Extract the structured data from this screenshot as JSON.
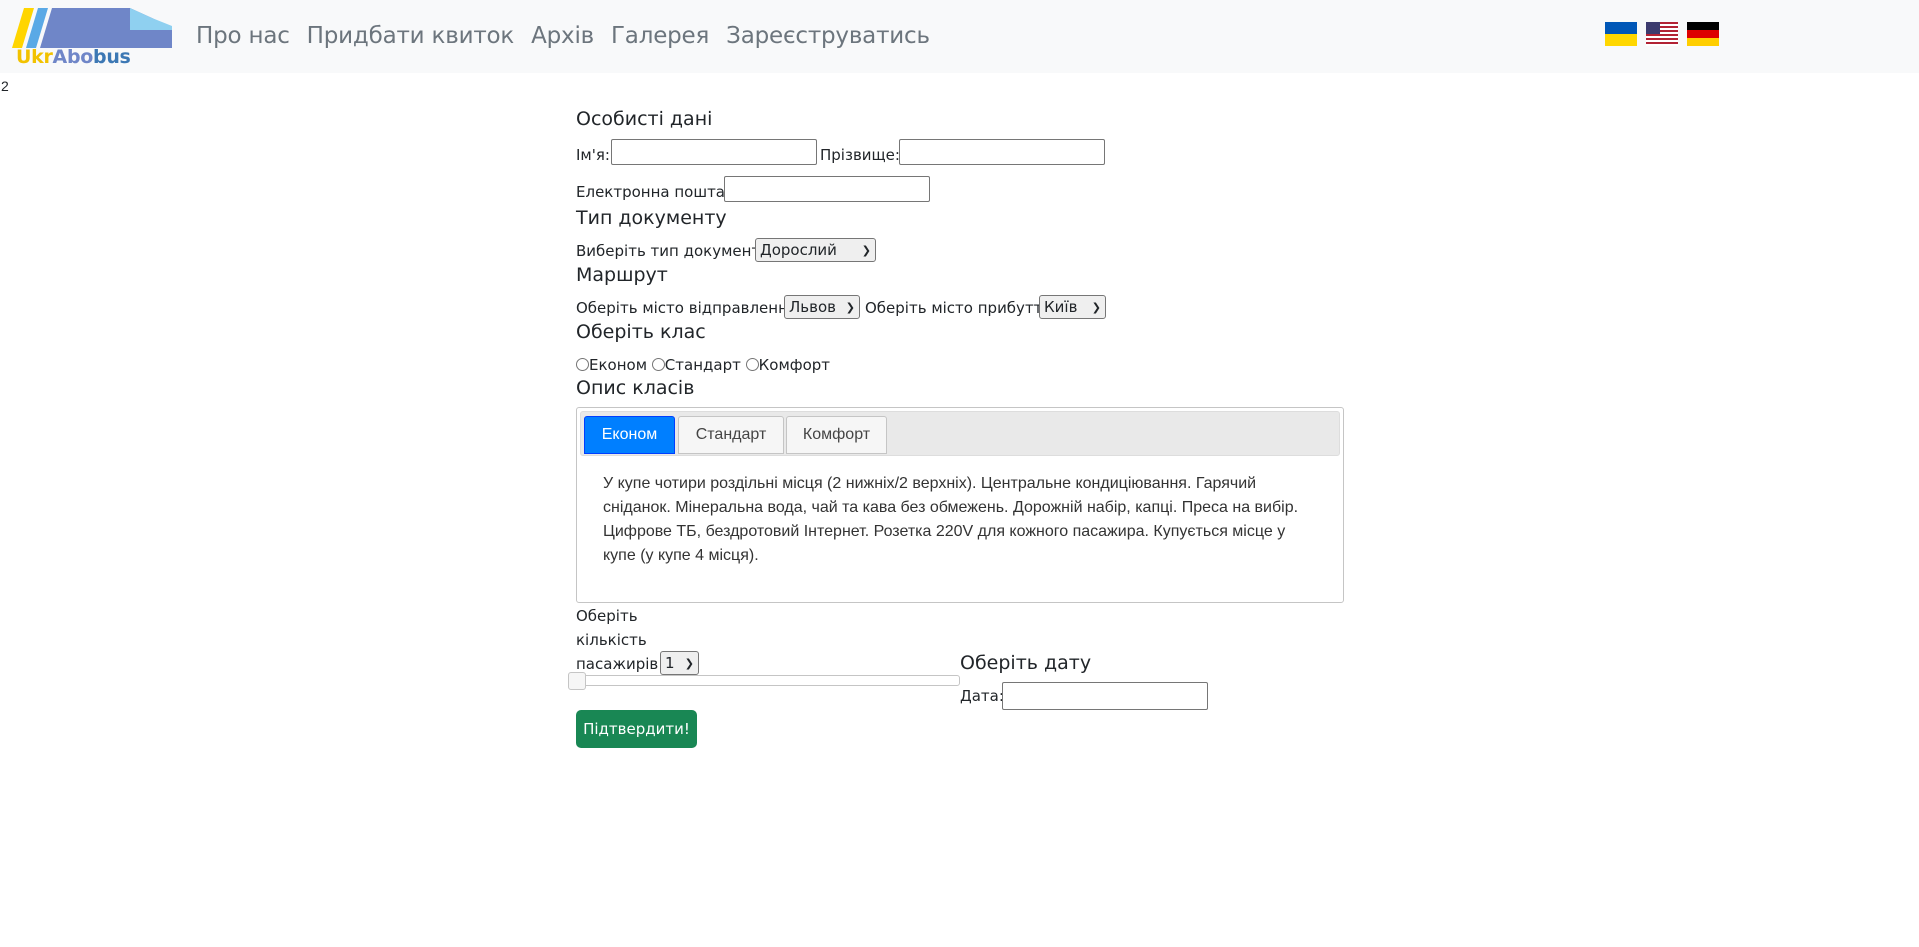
{
  "brand": {
    "text_ukr": "Ukr",
    "text_abo": "Abo",
    "text_bus": "bus"
  },
  "nav": {
    "items": [
      "Про нас",
      "Придбати квиток",
      "Архів",
      "Галерея",
      "Зареєструватись"
    ]
  },
  "flags": [
    "ukraine-flag-icon",
    "usa-flag-icon",
    "germany-flag-icon"
  ],
  "stray_text": "2",
  "personal": {
    "title": "Особисті дані",
    "first_name_label": "Ім'я:",
    "first_name_value": "",
    "last_name_label": "Прізвище:",
    "last_name_value": "",
    "email_label": "Електронна пошта :",
    "email_value": ""
  },
  "document": {
    "title": "Тип документу",
    "select_label": "Виберіть тип документу",
    "selected": "Дорослий"
  },
  "route": {
    "title": "Маршрут",
    "from_label": "Оберіть місто відправлення",
    "from_selected": "Львов",
    "to_label": "Оберіть місто прибуття",
    "to_selected": "Київ"
  },
  "class": {
    "title": "Оберіть клас",
    "options": [
      "Економ",
      "Стандарт",
      "Комфорт"
    ]
  },
  "class_desc": {
    "title": "Опис класів",
    "tabs": [
      "Економ",
      "Стандарт",
      "Комфорт"
    ],
    "active_tab": "Економ",
    "active_text": "У купе чотири роздільні місця (2 нижніх/2 верхніх). Центральне кондиціювання. Гарячий сніданок. Мінеральна вода, чай та кава без обмежень. Дорожній набір, капці. Преса на вибір. Цифрове ТБ, бездротовий Інтернет. Розетка 220V для кожного пасажира. Купується місце у купе (у купе 4 місця)."
  },
  "passengers": {
    "label_line1": "Оберіть",
    "label_line2": "кількість",
    "label_line3": "пасажирів",
    "selected": "1",
    "slider_fraction": 0
  },
  "date": {
    "title": "Оберіть дату",
    "label": "Дата:",
    "value": ""
  },
  "submit_label": "Підтвердити!",
  "colors": {
    "navbar_bg": "#f8f9fa",
    "tab_active": "#007fff",
    "submit": "#198754"
  }
}
